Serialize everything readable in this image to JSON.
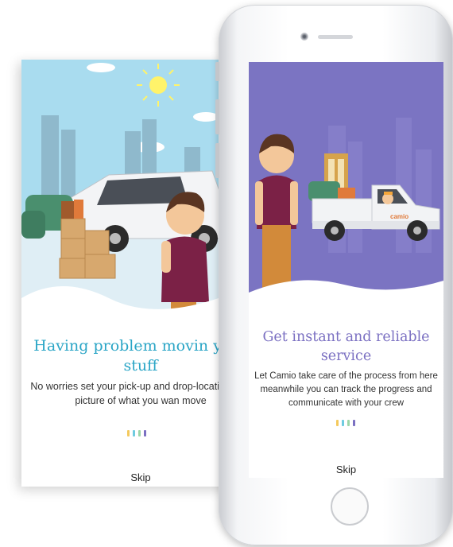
{
  "back_screen": {
    "title": "Having problem movin your stuff",
    "description": "No worries set your pick-up and drop-location with picture of what you wan move",
    "skip_label": "Skip",
    "sky_color": "#a9dcef",
    "dot_colors": [
      "#f4c95d",
      "#6ecbe0",
      "#9dd6a8",
      "#7b70c2"
    ]
  },
  "front_screen": {
    "title": "Get instant and reliable service",
    "description": "Let Camio take care of the process from here meanwhile you can track the progress and communicate with your crew",
    "skip_label": "Skip",
    "bg_color": "#7b74c2",
    "truck_logo": "camio",
    "dot_colors": [
      "#f4c95d",
      "#6ecbe0",
      "#9dd6a8",
      "#7b70c2"
    ]
  }
}
